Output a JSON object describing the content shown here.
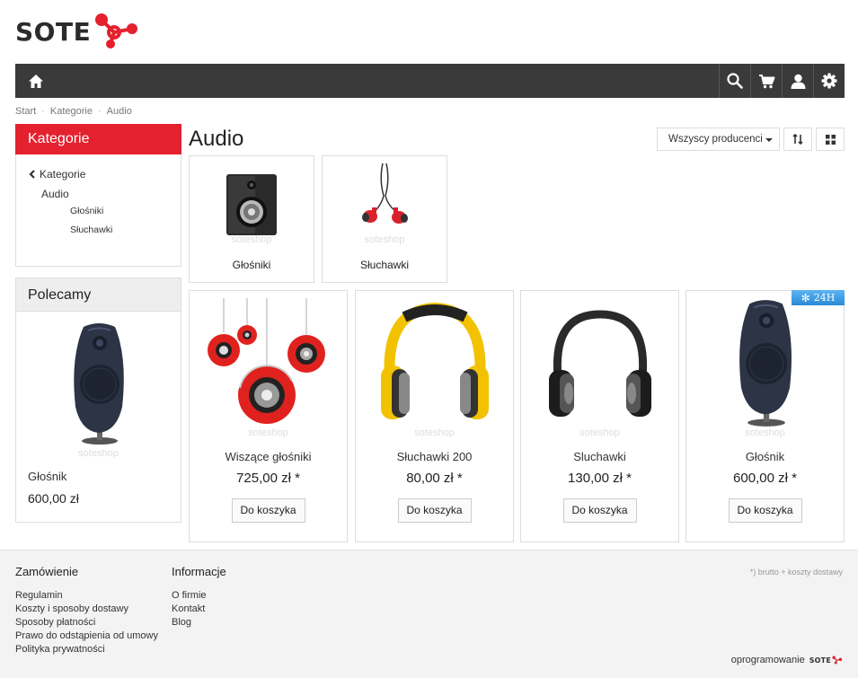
{
  "brand": {
    "name": "SOTE",
    "accent": "#e4212e",
    "dark": "#3a3a3a"
  },
  "navbar": {
    "icons": [
      "home-icon",
      "search-icon",
      "cart-icon",
      "user-icon",
      "gear-icon"
    ]
  },
  "breadcrumb": [
    "Start",
    "Kategorie",
    "Audio"
  ],
  "sidebar": {
    "categories": {
      "title": "Kategorie",
      "back_label": "Kategorie",
      "current": "Audio",
      "children": [
        "Głośniki",
        "Słuchawki"
      ]
    },
    "recommended": {
      "title": "Polecamy",
      "watermark": "soteshop",
      "product_name": "Głośnik",
      "price": "600,00 zł"
    }
  },
  "main": {
    "title": "Audio",
    "producer_filter": "Wszyscy producenci",
    "subcategories": [
      {
        "name": "Głośniki",
        "watermark": "soteshop"
      },
      {
        "name": "Słuchawki",
        "watermark": "soteshop"
      }
    ],
    "products": [
      {
        "name": "Wiszące głośniki",
        "price": "725,00 zł *",
        "button": "Do koszyka",
        "watermark": "soteshop"
      },
      {
        "name": "Słuchawki 200",
        "price": "80,00 zł *",
        "button": "Do koszyka",
        "watermark": "soteshop"
      },
      {
        "name": "Sluchawki",
        "price": "130,00 zł *",
        "button": "Do koszyka",
        "watermark": "soteshop"
      },
      {
        "name": "Głośnik",
        "price": "600,00 zł *",
        "button": "Do koszyka",
        "watermark": "soteshop",
        "badge": "24H"
      }
    ]
  },
  "footer": {
    "order": {
      "title": "Zamówienie",
      "links": [
        "Regulamin",
        "Koszty i sposoby dostawy",
        "Sposoby płatności",
        "Prawo do odstąpienia od umowy",
        "Polityka prywatności"
      ]
    },
    "info": {
      "title": "Informacje",
      "links": [
        "O firmie",
        "Kontakt",
        "Blog"
      ]
    },
    "note": "*) brutto + koszty dostawy",
    "software_label": "oprogramowanie",
    "software_brand": "SOTE"
  }
}
